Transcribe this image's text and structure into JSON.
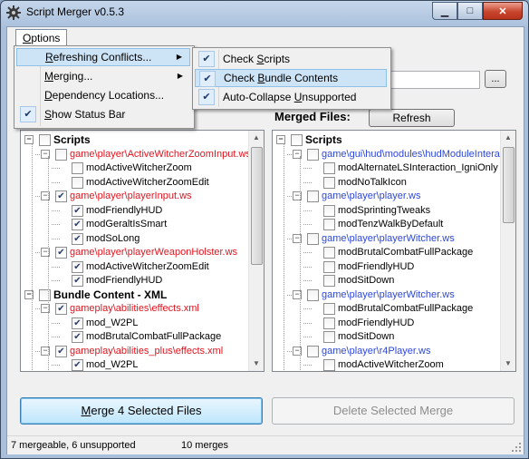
{
  "window": {
    "title": "Script Merger v0.5.3",
    "minimize_glyph": "▁",
    "maximize_glyph": "□",
    "close_glyph": "✕",
    "app_icon": "gear-icon"
  },
  "menubar": {
    "options_mnemonic": "O",
    "options_rest": "ptions"
  },
  "options_menu": {
    "items": [
      {
        "pre": "",
        "mn": "R",
        "post": "efreshing Conflicts...",
        "has_submenu": true,
        "checked": false
      },
      {
        "pre": "",
        "mn": "M",
        "post": "erging...",
        "has_submenu": true,
        "checked": false
      },
      {
        "pre": "",
        "mn": "D",
        "post": "ependency Locations...",
        "has_submenu": false,
        "checked": false
      },
      {
        "pre": "",
        "mn": "S",
        "post": "how Status Bar",
        "has_submenu": false,
        "checked": true
      }
    ],
    "check_glyph": "✔",
    "arrow_glyph": "▶"
  },
  "refresh_submenu": {
    "items": [
      {
        "pre": "Check ",
        "mn": "S",
        "post": "cripts",
        "checked": true
      },
      {
        "pre": "Check ",
        "mn": "B",
        "post": "undle Contents",
        "checked": true
      },
      {
        "pre": "Auto-Collapse ",
        "mn": "U",
        "post": "nsupported",
        "checked": true
      }
    ]
  },
  "browse_button": "...",
  "merged_files_label": "Merged Files:",
  "refresh_button": "Refresh",
  "left_tree": [
    {
      "text": "Scripts",
      "style": "bold",
      "level": 0,
      "exp": "⊟",
      "check": ""
    },
    {
      "text": "game\\player\\ActiveWitcherZoomInput.ws",
      "style": "red",
      "level": 1,
      "exp": "⊟",
      "check": ""
    },
    {
      "text": "modActiveWitcherZoom",
      "style": "",
      "level": 2,
      "check": ""
    },
    {
      "text": "modActiveWitcherZoomEdit",
      "style": "",
      "level": 2,
      "check": ""
    },
    {
      "text": "game\\player\\playerInput.ws",
      "style": "red",
      "level": 1,
      "exp": "⊟",
      "check": "✔"
    },
    {
      "text": "modFriendlyHUD",
      "style": "",
      "level": 2,
      "check": "✔"
    },
    {
      "text": "modGeraltIsSmart",
      "style": "",
      "level": 2,
      "check": "✔"
    },
    {
      "text": "modSoLong",
      "style": "",
      "level": 2,
      "check": "✔"
    },
    {
      "text": "game\\player\\playerWeaponHolster.ws",
      "style": "red",
      "level": 1,
      "exp": "⊟",
      "check": "✔"
    },
    {
      "text": "modActiveWitcherZoomEdit",
      "style": "",
      "level": 2,
      "check": "✔"
    },
    {
      "text": "modFriendlyHUD",
      "style": "",
      "level": 2,
      "check": "✔"
    },
    {
      "text": "Bundle Content - XML",
      "style": "bold",
      "level": 0,
      "exp": "⊟",
      "check": ""
    },
    {
      "text": "gameplay\\abilities\\effects.xml",
      "style": "red",
      "level": 1,
      "exp": "⊟",
      "check": "✔"
    },
    {
      "text": "mod_W2PL",
      "style": "",
      "level": 2,
      "check": "✔"
    },
    {
      "text": "modBrutalCombatFullPackage",
      "style": "",
      "level": 2,
      "check": "✔"
    },
    {
      "text": "gameplay\\abilities_plus\\effects.xml",
      "style": "red",
      "level": 1,
      "exp": "⊟",
      "check": "✔"
    },
    {
      "text": "mod_W2PL",
      "style": "",
      "level": 2,
      "check": "✔"
    }
  ],
  "right_tree": [
    {
      "text": "Scripts",
      "style": "bold",
      "level": 0,
      "exp": "⊟"
    },
    {
      "text": "game\\gui\\hud\\modules\\hudModuleInterac",
      "style": "blue",
      "level": 1,
      "exp": "⊟"
    },
    {
      "text": "modAlternateLSInteraction_IgniOnly",
      "style": "",
      "level": 2
    },
    {
      "text": "modNoTalkIcon",
      "style": "",
      "level": 2
    },
    {
      "text": "game\\player\\player.ws",
      "style": "blue",
      "level": 1,
      "exp": "⊟"
    },
    {
      "text": "modSprintingTweaks",
      "style": "",
      "level": 2
    },
    {
      "text": "modTenzWalkByDefault",
      "style": "",
      "level": 2
    },
    {
      "text": "game\\player\\playerWitcher.ws",
      "style": "blue",
      "level": 1,
      "exp": "⊟"
    },
    {
      "text": "modBrutalCombatFullPackage",
      "style": "",
      "level": 2
    },
    {
      "text": "modFriendlyHUD",
      "style": "",
      "level": 2
    },
    {
      "text": "modSitDown",
      "style": "",
      "level": 2
    },
    {
      "text": "game\\player\\playerWitcher.ws",
      "style": "blue",
      "level": 1,
      "exp": "⊟"
    },
    {
      "text": "modBrutalCombatFullPackage",
      "style": "",
      "level": 2
    },
    {
      "text": "modFriendlyHUD",
      "style": "",
      "level": 2
    },
    {
      "text": "modSitDown",
      "style": "",
      "level": 2
    },
    {
      "text": "game\\player\\r4Player.ws",
      "style": "blue",
      "level": 1,
      "exp": "⊟"
    },
    {
      "text": "modActiveWitcherZoom",
      "style": "",
      "level": 2
    }
  ],
  "merge_button": {
    "mn": "M",
    "post": "erge 4 Selected Files"
  },
  "delete_button": "Delete Selected Merge",
  "status": {
    "mergeable": "7 mergeable,  6 unsupported",
    "merges": "10 merges"
  },
  "scroll_up_glyph": "▲",
  "scroll_down_glyph": "▼"
}
